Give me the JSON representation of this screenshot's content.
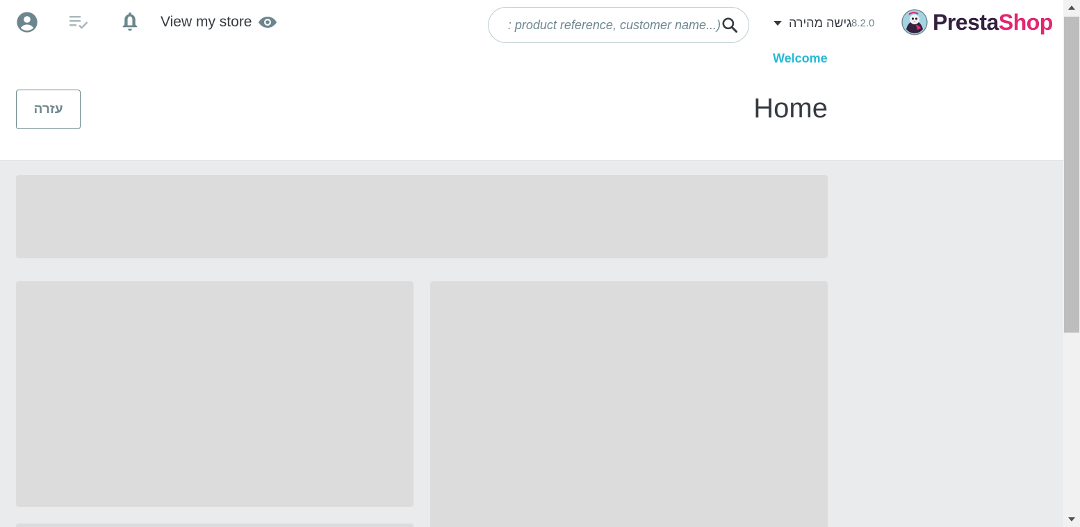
{
  "header": {
    "view_store_label": "View my store",
    "search": {
      "placeholder": ": product reference, customer name...)"
    },
    "quick_access_label": "גישה מהירה",
    "version": "8.2.0",
    "logo": {
      "part1": "Presta",
      "part2": "Shop"
    },
    "welcome_label": "Welcome",
    "help_button_label": "עזרה",
    "page_title": "Home"
  },
  "colors": {
    "accent": "#25b9d7",
    "logo_dark": "#34203f",
    "logo_pink": "#e2266f",
    "icon_gray": "#6c868e",
    "content_bg": "#eaebec",
    "placeholder": "#dcdcdc"
  },
  "icons": {
    "profile": "account-circle-icon",
    "tasks": "playlist-check-icon",
    "notifications": "bell-icon",
    "view_store": "eye-icon",
    "search": "search-icon",
    "dropdown": "caret-down-icon"
  }
}
